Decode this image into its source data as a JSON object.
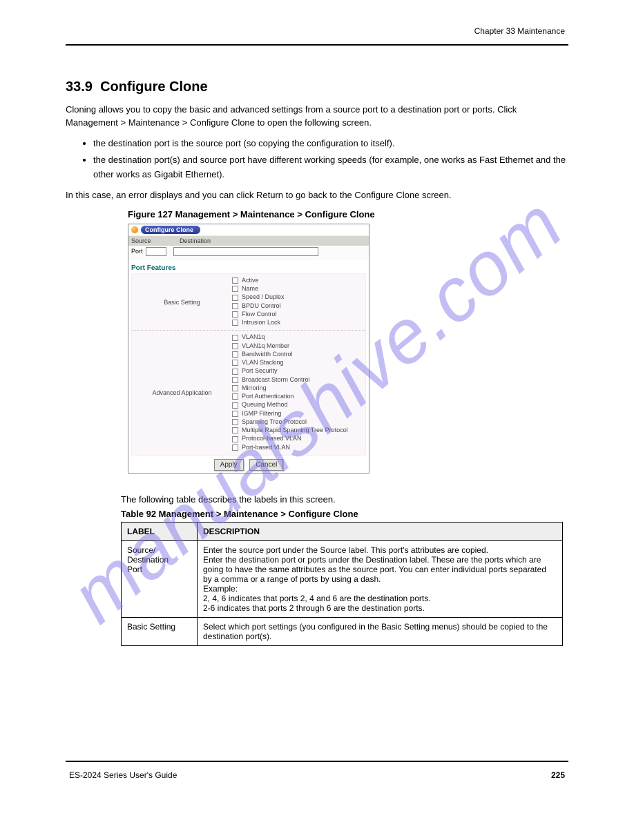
{
  "header": {
    "chapter": "Chapter 33 Maintenance"
  },
  "footer": {
    "left": "ES-2024 Series User's Guide",
    "page": "225"
  },
  "section": {
    "number": "33.9",
    "title": "Configure Clone",
    "intro": "Cloning allows you to copy the basic and advanced settings from a source port to a destination port or ports. Click Management > Maintenance > Configure Clone to open the following screen.",
    "bullets": [
      "the destination port is the source port (so copying the configuration to itself).",
      "the destination port(s) and source port have different working speeds (for example, one works as Fast Ethernet and the other works as Gigabit Ethernet)."
    ],
    "note_line": "In this case, an error displays and you can click Return to go back to the Configure Clone screen."
  },
  "figure": {
    "caption": "Figure 127   Management > Maintenance > Configure Clone",
    "title": "Configure Clone",
    "header_cols": {
      "c1": "Source",
      "c2": "Destination"
    },
    "port_label": "Port",
    "section_label": "Port Features",
    "basic_label": "Basic Setting",
    "advanced_label": "Advanced Application",
    "basic_items": [
      "Active",
      "Name",
      "Speed / Duplex",
      "BPDU Control",
      "Flow Control",
      "Intrusion Lock"
    ],
    "advanced_items": [
      "VLAN1q",
      "VLAN1q Member",
      "Bandwidth Control",
      "VLAN Stacking",
      "Port Security",
      "Broadcast Storm Control",
      "Mirroring",
      "Port Authentication",
      "Queuing Method",
      "IGMP Filtering",
      "Spanning Tree Protocol",
      "Multiple Rapid Spanning Tree Protocol",
      "Protocol-based VLAN",
      "Port-based VLAN"
    ],
    "apply_label": "Apply",
    "cancel_label": "Cancel"
  },
  "desc_intro": "The following table describes the labels in this screen.",
  "table": {
    "caption": "Table 92   Management > Maintenance > Configure Clone",
    "h1": "LABEL",
    "h2": "DESCRIPTION",
    "rows": [
      {
        "label": "Source/\nDestination\nPort",
        "desc": "Enter the source port under the Source label. This port's attributes are copied.\nEnter the destination port or ports under the Destination label. These are the ports which are going to have the same attributes as the source port. You can enter individual ports separated by a comma or a range of ports by using a dash.\nExample:\n2, 4, 6 indicates that ports 2, 4 and 6 are the destination ports.\n2-6 indicates that ports 2 through 6 are the destination ports."
      },
      {
        "label": "Basic Setting",
        "desc": "Select which port settings (you configured in the Basic Setting menus) should be copied to the destination port(s)."
      }
    ]
  }
}
